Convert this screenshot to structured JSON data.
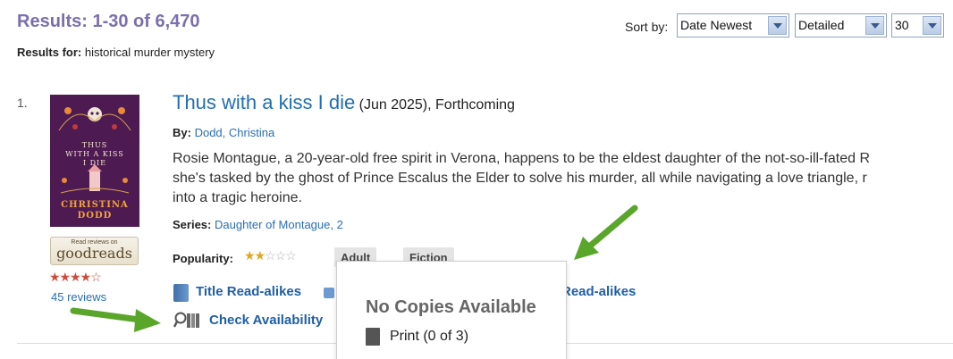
{
  "header": {
    "results_title": "Results: 1-30 of 6,470",
    "results_for_label": "Results for:",
    "results_for_query": "historical murder mystery"
  },
  "sort": {
    "label": "Sort by:",
    "order_value": "Date Newest",
    "view_value": "Detailed",
    "per_page_value": "30"
  },
  "result": {
    "number": "1.",
    "cover": {
      "title_lines": [
        "THUS",
        "WITH A KISS",
        "I DIE"
      ],
      "author_lines": [
        "CHRISTINA",
        "DODD"
      ]
    },
    "goodreads": {
      "top_text": "Read reviews on",
      "main_text": "goodreads",
      "stars": "★★★★☆",
      "reviews_link": "45 reviews"
    },
    "title_link": "Thus with a kiss I die",
    "title_meta": " (Jun 2025), Forthcoming",
    "by_label": "By:",
    "author_link": "Dodd, Christina",
    "summary_lines": [
      "Rosie Montague, a 20-year-old free spirit in Verona, happens to be the eldest daughter of the not-so-ill-fated R",
      "she's tasked by the ghost of Prince Escalus the Elder to solve his murder, all while navigating a love triangle, r",
      "into a tragic heroine."
    ],
    "series_label": "Series:",
    "series_link": "Daughter of Montague, 2",
    "popularity_label": "Popularity:",
    "popularity_stars_on": "★★",
    "popularity_stars_off": "☆☆☆",
    "tags": [
      "Adult",
      "Fiction"
    ],
    "title_readalikes": "Title Read-alikes",
    "other_readalikes": "Read-alikes",
    "check_availability": "Check Availability"
  },
  "availability_popup": {
    "heading": "No Copies Available",
    "print_text": "Print (0 of 3)"
  },
  "colors": {
    "title_purple": "#7b6fad",
    "link_blue": "#1f6fb2",
    "arrow_green": "#5aa62a"
  }
}
